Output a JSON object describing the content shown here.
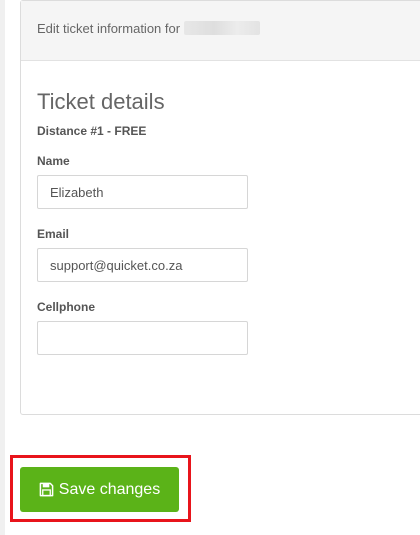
{
  "panel": {
    "header_text": "Edit ticket information for"
  },
  "ticket": {
    "section_title": "Ticket details",
    "ticket_type": "Distance #1 - FREE"
  },
  "fields": {
    "name": {
      "label": "Name",
      "value": "Elizabeth",
      "placeholder": ""
    },
    "email": {
      "label": "Email",
      "value": "support@quicket.co.za",
      "placeholder": ""
    },
    "cellphone": {
      "label": "Cellphone",
      "value": "",
      "placeholder": ""
    }
  },
  "actions": {
    "save_label": "Save changes",
    "save_icon": "floppy-disk-icon"
  },
  "colors": {
    "accent": "#5bb318",
    "highlight": "#e8141b"
  }
}
